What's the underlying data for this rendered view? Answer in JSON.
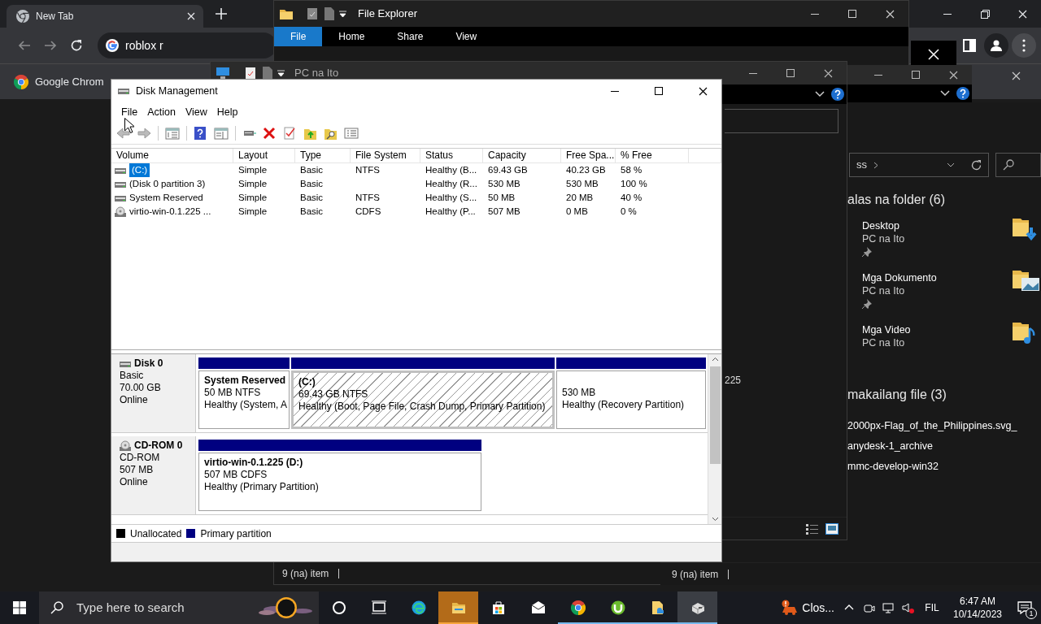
{
  "chrome": {
    "tabs": [
      {
        "title": "New Tab",
        "selected": true
      }
    ],
    "address": "roblox r",
    "infobar_text": "Google Chrom"
  },
  "file_explorer": {
    "title": "File Explorer",
    "ribbon_tabs": [
      {
        "label": "File",
        "selected": true
      },
      {
        "label": "Home",
        "selected": false
      },
      {
        "label": "Share",
        "selected": false
      },
      {
        "label": "View",
        "selected": false
      }
    ],
    "status": "9 (na) item"
  },
  "pc_window": {
    "title": "PC na Ito",
    "visible_label": "225"
  },
  "explorer_behind": {
    "address": "ss",
    "frequent_heading": "alas na folder (6)",
    "folders": [
      {
        "name": "Desktop",
        "location": "PC na Ito",
        "pinned": true
      },
      {
        "name": "Mga Dokumento",
        "location": "PC na Ito",
        "pinned": true
      },
      {
        "name": "Mga Video",
        "location": "PC na Ito",
        "pinned": false
      }
    ],
    "recent_heading": "makailang file (3)",
    "recent_files": [
      "2000px-Flag_of_the_Philippines.svg_",
      "anydesk-1_archive",
      "mmc-develop-win32"
    ],
    "status": "9 (na) item"
  },
  "disk_management": {
    "title": "Disk Management",
    "menu": [
      "File",
      "Action",
      "View",
      "Help"
    ],
    "columns": [
      "Volume",
      "Layout",
      "Type",
      "File System",
      "Status",
      "Capacity",
      "Free Spa...",
      "% Free"
    ],
    "volumes": [
      {
        "kind": "disk",
        "selected": true,
        "cells": [
          "(C:)",
          "Simple",
          "Basic",
          "NTFS",
          "Healthy (B...",
          "69.43 GB",
          "40.23 GB",
          "58 %"
        ]
      },
      {
        "kind": "disk",
        "selected": false,
        "cells": [
          "(Disk 0 partition 3)",
          "Simple",
          "Basic",
          "",
          "Healthy (R...",
          "530 MB",
          "530 MB",
          "100 %"
        ]
      },
      {
        "kind": "disk",
        "selected": false,
        "cells": [
          "System Reserved",
          "Simple",
          "Basic",
          "NTFS",
          "Healthy (S...",
          "50 MB",
          "20 MB",
          "40 %"
        ]
      },
      {
        "kind": "cdrom",
        "selected": false,
        "cells": [
          "virtio-win-0.1.225 ...",
          "Simple",
          "Basic",
          "CDFS",
          "Healthy (P...",
          "507 MB",
          "0 MB",
          "0 %"
        ]
      }
    ],
    "disks": [
      {
        "kind": "disk",
        "name": "Disk 0",
        "type": "Basic",
        "size": "70.00 GB",
        "state": "Online",
        "partitions": [
          {
            "label": "System Reserved",
            "size": "50 MB NTFS",
            "status": "Healthy (System, A",
            "selected": false
          },
          {
            "label": "(C:)",
            "size": "69.43 GB NTFS",
            "status": "Healthy (Boot, Page File, Crash Dump, Primary Partition)",
            "selected": true
          },
          {
            "size": "530 MB",
            "status": "Healthy (Recovery Partition)",
            "selected": false
          }
        ]
      },
      {
        "kind": "cdrom",
        "name": "CD-ROM 0",
        "type": "CD-ROM",
        "size": "507 MB",
        "state": "Online",
        "partitions": [
          {
            "label": "virtio-win-0.1.225  (D:)",
            "size": "507 MB CDFS",
            "status": "Healthy (Primary Partition)",
            "selected": false
          }
        ]
      }
    ],
    "legend": [
      {
        "label": "Unallocated",
        "color": "#000000"
      },
      {
        "label": "Primary partition",
        "color": "#000080"
      }
    ]
  },
  "taskbar": {
    "search_placeholder": "Type here to search",
    "apps": [
      {
        "kind": "cortana",
        "running": false,
        "selected": false,
        "flashing": false
      },
      {
        "kind": "taskview",
        "running": false,
        "selected": false,
        "flashing": false
      },
      {
        "kind": "edge",
        "running": false,
        "selected": false,
        "flashing": false
      },
      {
        "kind": "explorer",
        "running": true,
        "selected": false,
        "flashing": true
      },
      {
        "kind": "store",
        "running": false,
        "selected": false,
        "flashing": false
      },
      {
        "kind": "mail",
        "running": false,
        "selected": false,
        "flashing": false
      },
      {
        "kind": "chrome",
        "running": true,
        "selected": false,
        "flashing": false
      },
      {
        "kind": "utorrent",
        "running": true,
        "selected": false,
        "flashing": false
      },
      {
        "kind": "files",
        "running": true,
        "selected": false,
        "flashing": false
      },
      {
        "kind": "diskmgmt",
        "running": true,
        "selected": true,
        "flashing": false
      }
    ],
    "notification": "Clos...",
    "language": "FIL",
    "time": "6:47 AM",
    "date": "10/14/2023",
    "notification_count": "1"
  }
}
